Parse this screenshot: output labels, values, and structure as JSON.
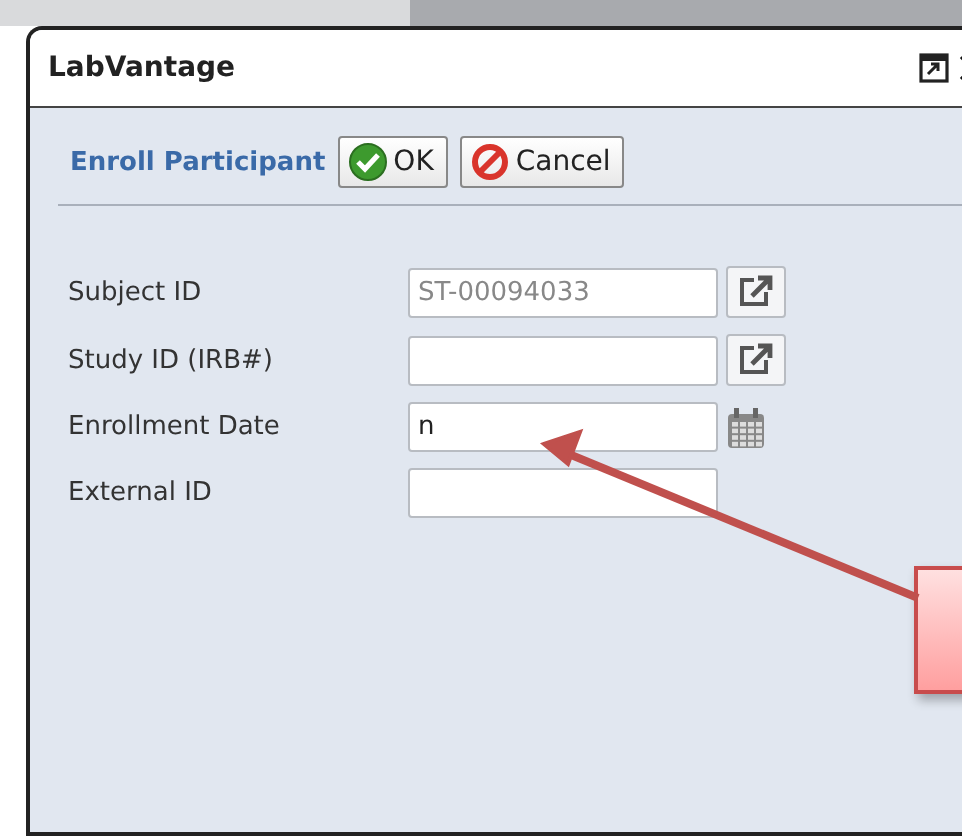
{
  "window": {
    "title": "LabVantage"
  },
  "toolbar": {
    "title": "Enroll Participant",
    "buttons": [
      {
        "label": "OK",
        "kind": "ok"
      },
      {
        "label": "Cancel",
        "kind": "cancel"
      }
    ]
  },
  "fields": [
    {
      "label": "Subject ID",
      "kind": "lookup",
      "value": "ST-00094033",
      "readonly": true
    },
    {
      "label": "Study ID (IRB#)",
      "kind": "lookup"
    },
    {
      "label": "Enrollment Date",
      "kind": "date",
      "value": "n"
    },
    {
      "label": "External ID",
      "kind": "text"
    }
  ]
}
